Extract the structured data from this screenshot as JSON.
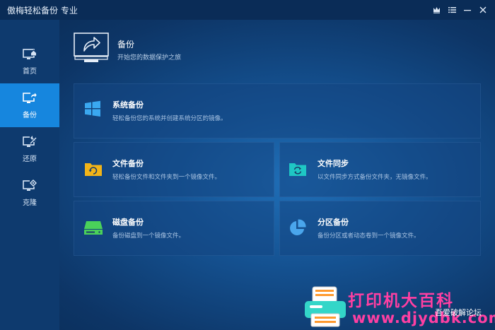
{
  "window": {
    "title": "傲梅轻松备份 专业"
  },
  "sidebar": {
    "items": [
      {
        "label": "首页",
        "icon": "monitor-home-icon"
      },
      {
        "label": "备份",
        "icon": "monitor-backup-icon",
        "active": true
      },
      {
        "label": "还原",
        "icon": "monitor-restore-icon"
      },
      {
        "label": "克隆",
        "icon": "monitor-clone-icon"
      }
    ]
  },
  "header": {
    "title": "备份",
    "subtitle": "开始您的数据保护之旅",
    "icon": "monitor-share-arrow-icon"
  },
  "cards": {
    "system_backup": {
      "title": "系统备份",
      "desc": "轻松备份您的系统并创建系统分区的镜像。",
      "icon": "windows-logo-icon"
    },
    "file_backup": {
      "title": "文件备份",
      "desc": "轻松备份文件和文件夹到一个镜像文件。",
      "icon": "folder-refresh-icon"
    },
    "file_sync": {
      "title": "文件同步",
      "desc": "以文件同步方式备份文件夹，无镜像文件。",
      "icon": "folder-sync-icon"
    },
    "disk_backup": {
      "title": "磁盘备份",
      "desc": "备份磁盘到一个镜像文件。",
      "icon": "disk-drive-icon"
    },
    "partition_backup": {
      "title": "分区备份",
      "desc": "备份分区或者动态卷到一个镜像文件。",
      "icon": "pie-chart-icon"
    }
  },
  "watermark": {
    "brand": "打印机大百科",
    "url": "www.djydbk.com",
    "forum": "吾爱破解论坛"
  },
  "colors": {
    "accent": "#1686de",
    "sidebar": "#0e3a6e",
    "titlebar": "#0a2c57",
    "windows_blue": "#3aa8f0",
    "folder_yellow": "#f2b418",
    "sync_teal": "#1fc7c4",
    "disk_green": "#4ad15a",
    "pie_blue": "#4aa6ec",
    "watermark_pink": "#ff3fa2"
  }
}
